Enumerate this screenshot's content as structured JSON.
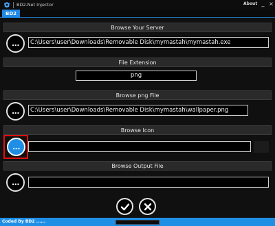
{
  "window": {
    "title": "BD2.Net Injector",
    "about_label": "About",
    "minimize_glyph": "_",
    "close_glyph": "×"
  },
  "tabs": [
    {
      "label": "BD2",
      "active": true
    }
  ],
  "sections": {
    "server": {
      "header": "Browse Your Server",
      "path": "C:\\Users\\user\\Downloads\\Removable Disk\\mymastah\\mymastah.exe",
      "button_label": "..."
    },
    "extension": {
      "header": "File Extension",
      "value": "png"
    },
    "png": {
      "header": "Browse png File",
      "path": "C:\\Users\\user\\Downloads\\Removable Disk\\mymastah\\wallpaper.png",
      "button_label": "..."
    },
    "icon": {
      "header": "Browse Icon",
      "path": "",
      "button_label": "..."
    },
    "output": {
      "header": "Browse Output File",
      "path": "",
      "button_label": "..."
    }
  },
  "actions": {
    "confirm_icon": "checkmark-icon",
    "cancel_icon": "x-icon"
  },
  "status": {
    "text": "Coded By BD2 ......",
    "progress": 0
  },
  "colors": {
    "accent": "#1f8fe6",
    "highlight": "#e01010",
    "background": "#101010",
    "header": "#2a2a2a"
  }
}
